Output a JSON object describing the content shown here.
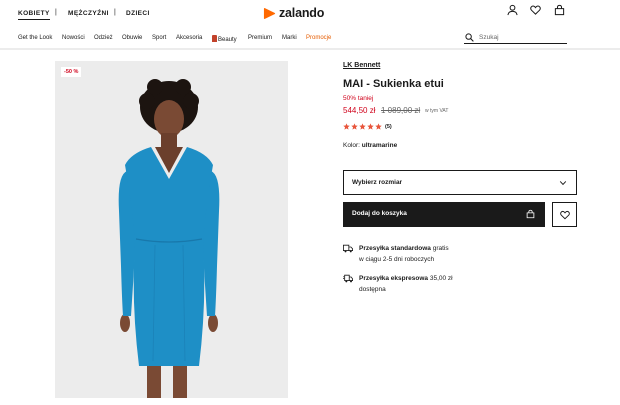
{
  "header": {
    "genders": [
      "KOBIETY",
      "MĘŻCZYŹNI",
      "DZIECI"
    ],
    "separator": "|",
    "logo_text": "zalando",
    "brand_color": "#ff6900",
    "icons": [
      "user-icon",
      "heart-icon",
      "shopping-bag-icon"
    ]
  },
  "nav": {
    "items": [
      "Get the Look",
      "Nowości",
      "Odzież",
      "Obuwie",
      "Sport",
      "Akcesoria",
      "Beauty",
      "Premium",
      "Marki",
      "Promocje"
    ],
    "promo_color": "#e65c00"
  },
  "search": {
    "placeholder": "Szukaj"
  },
  "product": {
    "badge": "-50 %",
    "brand": "LK Bennett",
    "title": "MAI - Sukienka etui",
    "discount_text": "50% taniej",
    "price": "544,50 zł",
    "old_price": "1 089,00 zł",
    "vat_note": "w tym VAT",
    "rating_stars": 5,
    "review_count": "(5)",
    "color_label": "Kolor:",
    "color_value": "ultramarine",
    "dress_color": "#1e8fc6",
    "sale_color": "#d0021b"
  },
  "actions": {
    "size_select": "Wybierz rozmiar",
    "add_to_cart": "Dodaj do koszyka"
  },
  "shipping": {
    "standard_title": "Przesyłka standardowa",
    "standard_cost": "gratis",
    "standard_time": "w ciągu 2-5 dni roboczych",
    "express_title": "Przesyłka ekspresowa",
    "express_cost": "35,00 zł",
    "express_availability": "dostępna"
  }
}
